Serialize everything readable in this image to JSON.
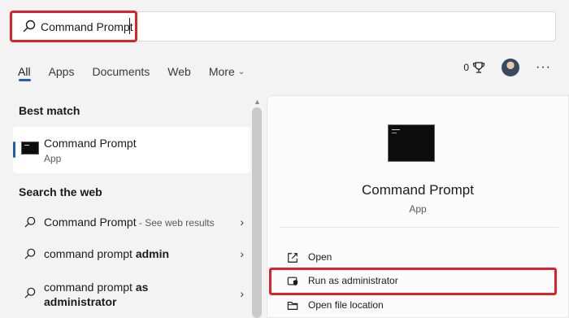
{
  "search": {
    "value": "Command Prompt",
    "placeholder": "Type here to search"
  },
  "tabs": [
    {
      "label": "All",
      "active": true
    },
    {
      "label": "Apps"
    },
    {
      "label": "Documents"
    },
    {
      "label": "Web"
    },
    {
      "label": "More"
    }
  ],
  "header_tools": {
    "points": "0",
    "trophy_icon": "trophy-icon",
    "more_icon": "ellipsis-icon"
  },
  "left": {
    "best_match_heading": "Best match",
    "best_match": {
      "title": "Command Prompt",
      "subtitle": "App"
    },
    "search_web_heading": "Search the web",
    "web_results": [
      {
        "main": "Command Prompt",
        "hint": " - See web results"
      },
      {
        "main": "command prompt ",
        "bold": "admin"
      },
      {
        "main": "command prompt ",
        "bold": "as",
        "line2": "administrator"
      }
    ]
  },
  "preview": {
    "title": "Command Prompt",
    "subtitle": "App",
    "actions": [
      {
        "label": "Open",
        "icon": "open-external-icon"
      },
      {
        "label": "Run as administrator",
        "icon": "shield-icon"
      },
      {
        "label": "Open file location",
        "icon": "folder-icon"
      }
    ]
  },
  "colors": {
    "accent": "#1f5fb3",
    "highlight": "#d9232d",
    "background": "#f3f3f3"
  }
}
